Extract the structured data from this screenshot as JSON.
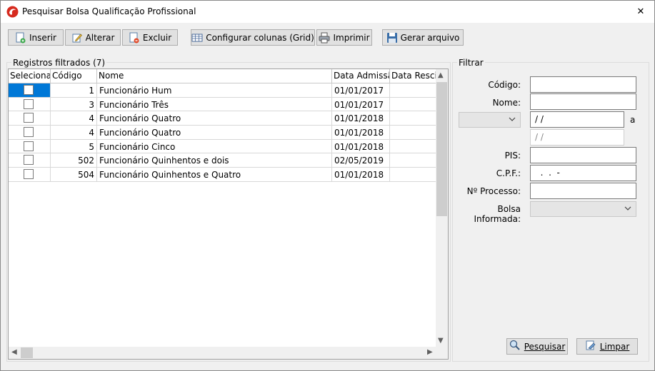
{
  "window": {
    "title": "Pesquisar Bolsa Qualificação Profissional",
    "close_glyph": "✕",
    "app_icon": "red-swirl-logo-icon"
  },
  "toolbar": {
    "insert": {
      "label": "Inserir",
      "icon": "insert-document-icon"
    },
    "edit": {
      "label": "Alterar",
      "icon": "edit-pencil-icon"
    },
    "delete": {
      "label": "Excluir",
      "icon": "delete-document-icon"
    },
    "configure": {
      "label": "Configurar colunas (Grid)",
      "icon": "columns-grid-icon"
    },
    "print": {
      "label": "Imprimir",
      "icon": "printer-icon"
    },
    "export": {
      "label": "Gerar arquivo",
      "icon": "save-disk-icon"
    }
  },
  "grid": {
    "group_label": "Registros filtrados (7)",
    "columns": [
      "Selecionar",
      "Código",
      "Nome",
      "Data Admissão",
      "Data Rescisão"
    ],
    "rows": [
      {
        "codigo": "1",
        "nome": "Funcionário Hum",
        "admissao": "01/01/2017",
        "rescisao": ""
      },
      {
        "codigo": "3",
        "nome": "Funcionário Três",
        "admissao": "01/01/2017",
        "rescisao": ""
      },
      {
        "codigo": "4",
        "nome": "Funcionário Quatro",
        "admissao": "01/01/2018",
        "rescisao": ""
      },
      {
        "codigo": "4",
        "nome": "Funcionário Quatro",
        "admissao": "01/01/2018",
        "rescisao": ""
      },
      {
        "codigo": "5",
        "nome": "Funcionário Cinco",
        "admissao": "01/01/2018",
        "rescisao": ""
      },
      {
        "codigo": "502",
        "nome": "Funcionário Quinhentos e dois",
        "admissao": "02/05/2019",
        "rescisao": ""
      },
      {
        "codigo": "504",
        "nome": "Funcionário Quinhentos e Quatro",
        "admissao": "01/01/2018",
        "rescisao": ""
      }
    ]
  },
  "filter": {
    "group_label": "Filtrar",
    "codigo_label": "Código:",
    "codigo_value": "",
    "nome_label": "Nome:",
    "nome_value": "",
    "date_type_value": "",
    "date_from": " / /",
    "date_separator": "a",
    "date_to": " / /",
    "pis_label": "PIS:",
    "pis_value": "",
    "cpf_label": "C.P.F.:",
    "cpf_value": "  .  .  -",
    "processo_label": "Nº Processo:",
    "processo_value": "",
    "bolsa_label": "Bolsa Informada:",
    "bolsa_value": "",
    "search_button": {
      "label": "Pesquisar",
      "icon": "magnifier-icon"
    },
    "clear_button": {
      "label": "Limpar",
      "icon": "eraser-icon"
    }
  }
}
